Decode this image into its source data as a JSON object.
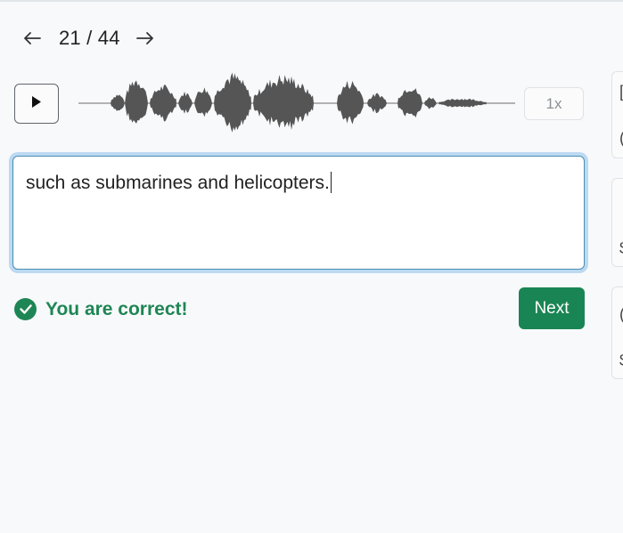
{
  "pager": {
    "current": "21 / 44",
    "prev_icon": "arrow-left-icon",
    "next_icon": "arrow-right-icon"
  },
  "player": {
    "play_icon": "play-icon",
    "speed_label": "1x"
  },
  "answer": {
    "text": "such as submarines and helicopters."
  },
  "feedback": {
    "icon": "check-circle-icon",
    "message": "You are correct!",
    "color": "#1e8654"
  },
  "actions": {
    "next_label": "Next",
    "next_color": "#1a8554"
  },
  "side_cards": [
    {
      "fragments": [
        "[",
        "("
      ]
    },
    {
      "fragments": [
        "",
        "$"
      ]
    },
    {
      "fragments": [
        "(",
        "$"
      ]
    }
  ]
}
